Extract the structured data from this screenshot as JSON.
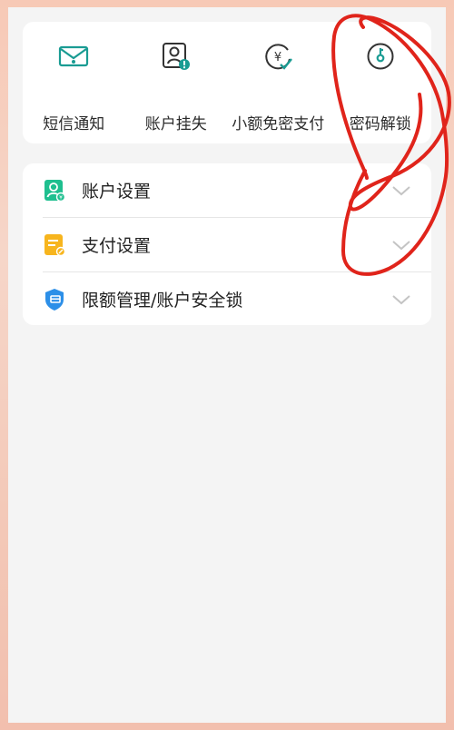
{
  "quick_actions": [
    {
      "label": "短信通知",
      "icon": "sms-notification-icon"
    },
    {
      "label": "账户挂失",
      "icon": "account-loss-icon"
    },
    {
      "label": "小额免密支付",
      "icon": "small-payment-icon"
    },
    {
      "label": "密码解锁",
      "icon": "password-unlock-icon"
    }
  ],
  "settings": [
    {
      "label": "账户设置",
      "icon": "account-settings-icon",
      "color": "#1fbf8f"
    },
    {
      "label": "支付设置",
      "icon": "payment-settings-icon",
      "color": "#f7b51e"
    },
    {
      "label": "限额管理/账户安全锁",
      "icon": "limit-security-lock-icon",
      "color": "#2c8fe8"
    }
  ],
  "colors": {
    "accent": "#1a9c93",
    "annotation": "#e0241b"
  }
}
